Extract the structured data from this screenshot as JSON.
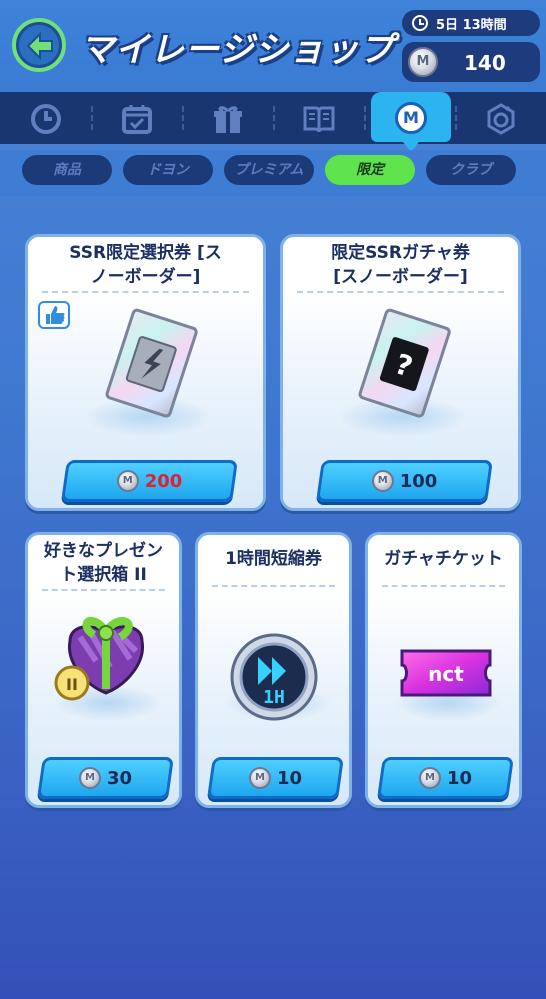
{
  "header": {
    "title": "マイレージショップ",
    "timer": "5日 13時間",
    "balance": "140",
    "coin_letter": "M"
  },
  "nav": {
    "icons": [
      "clock-icon",
      "calendar-icon",
      "gift-icon",
      "book-icon",
      "mileage-icon",
      "emblem-icon"
    ],
    "active_index": 4
  },
  "subtabs": [
    "商品",
    "ドヨン",
    "プレミアム",
    "限定",
    "クラブ"
  ],
  "active_subtab": "限定",
  "items": [
    {
      "title_line1": "SSR限定選択券 [ス",
      "title_line2": "ノーボーダー]",
      "price": "200",
      "price_color": "#e0222c",
      "liked": true
    },
    {
      "title_line1": "限定SSRガチャ券",
      "title_line2": "[スノーボーダー]",
      "price": "100"
    },
    {
      "title_line1": "好きなプレゼン",
      "title_line2": "ト選択箱 II",
      "price": "30",
      "badge": "II"
    },
    {
      "title_line1": "1時間短縮券",
      "title_line2": "",
      "price": "10",
      "clock_label": "1H"
    },
    {
      "title_line1": "ガチャチケット",
      "title_line2": "",
      "price": "10",
      "ticket_label": "nct"
    }
  ],
  "colors": {
    "accent_green": "#5ee34c",
    "nav_dark": "#1a3670",
    "price_button": "#1fa6ef"
  }
}
